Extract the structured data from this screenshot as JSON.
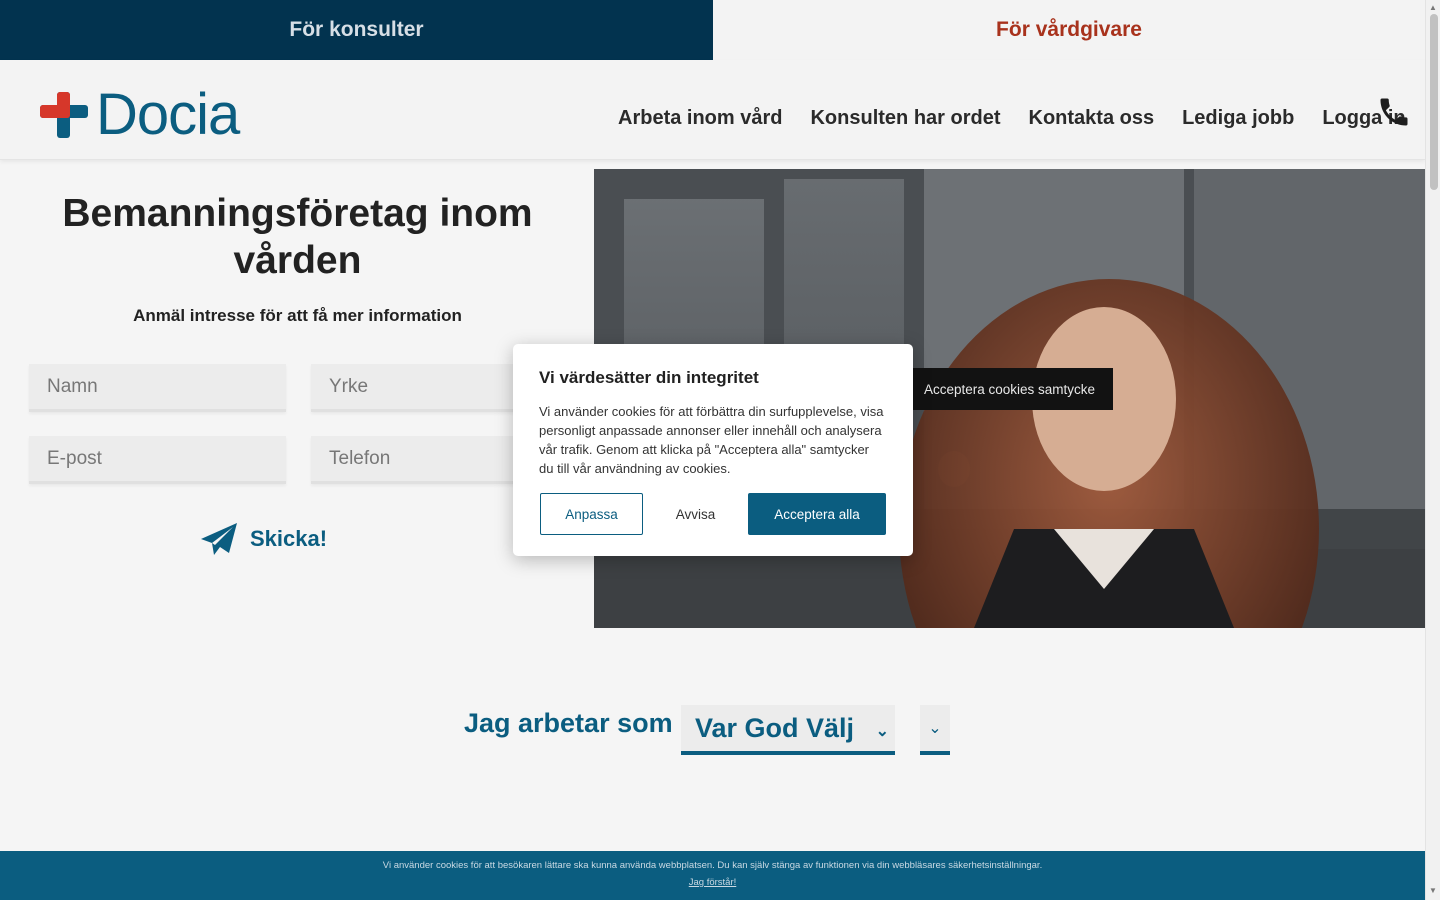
{
  "topbar": {
    "consultants_label": "För konsulter",
    "caregivers_label": "För vårdgivare"
  },
  "header": {
    "logo_text": "Docia",
    "nav": [
      "Arbeta inom vård",
      "Konsulten har ordet",
      "Kontakta oss",
      "Lediga jobb",
      "Logga in"
    ],
    "phone_icon": "phone-icon"
  },
  "hero": {
    "title": "Bemanningsföretag inom vården",
    "subtitle": "Anmäl intresse för att få mer information",
    "form": {
      "name_placeholder": "Namn",
      "profession_placeholder": "Yrke",
      "email_placeholder": "E-post",
      "phone_placeholder": "Telefon",
      "submit_label": "Skicka!"
    },
    "cookie_consent_button": "Acceptera cookies samtycke"
  },
  "role_selector": {
    "label": "Jag arbetar som",
    "selected": "Var God Välj"
  },
  "consent_modal": {
    "title": "Vi värdesätter din integritet",
    "body": "Vi använder cookies för att förbättra din surfupplevelse, visa personligt anpassade annonser eller innehåll och analysera vår trafik. Genom att klicka på \"Acceptera alla\" samtycker du till vår användning av cookies.",
    "customize_label": "Anpassa",
    "reject_label": "Avvisa",
    "accept_all_label": "Acceptera alla"
  },
  "cookie_bar": {
    "text": "Vi använder cookies för att besökaren lättare ska kunna använda webbplatsen. Du kan själv stänga av funktionen via din webbläsares säkerhetsinställningar.",
    "ok_label": "Jag förstår!"
  },
  "colors": {
    "brand_blue": "#0b5d80",
    "dark_navy": "#02334f",
    "care_red": "#a8321c",
    "logo_red": "#d6372a"
  }
}
